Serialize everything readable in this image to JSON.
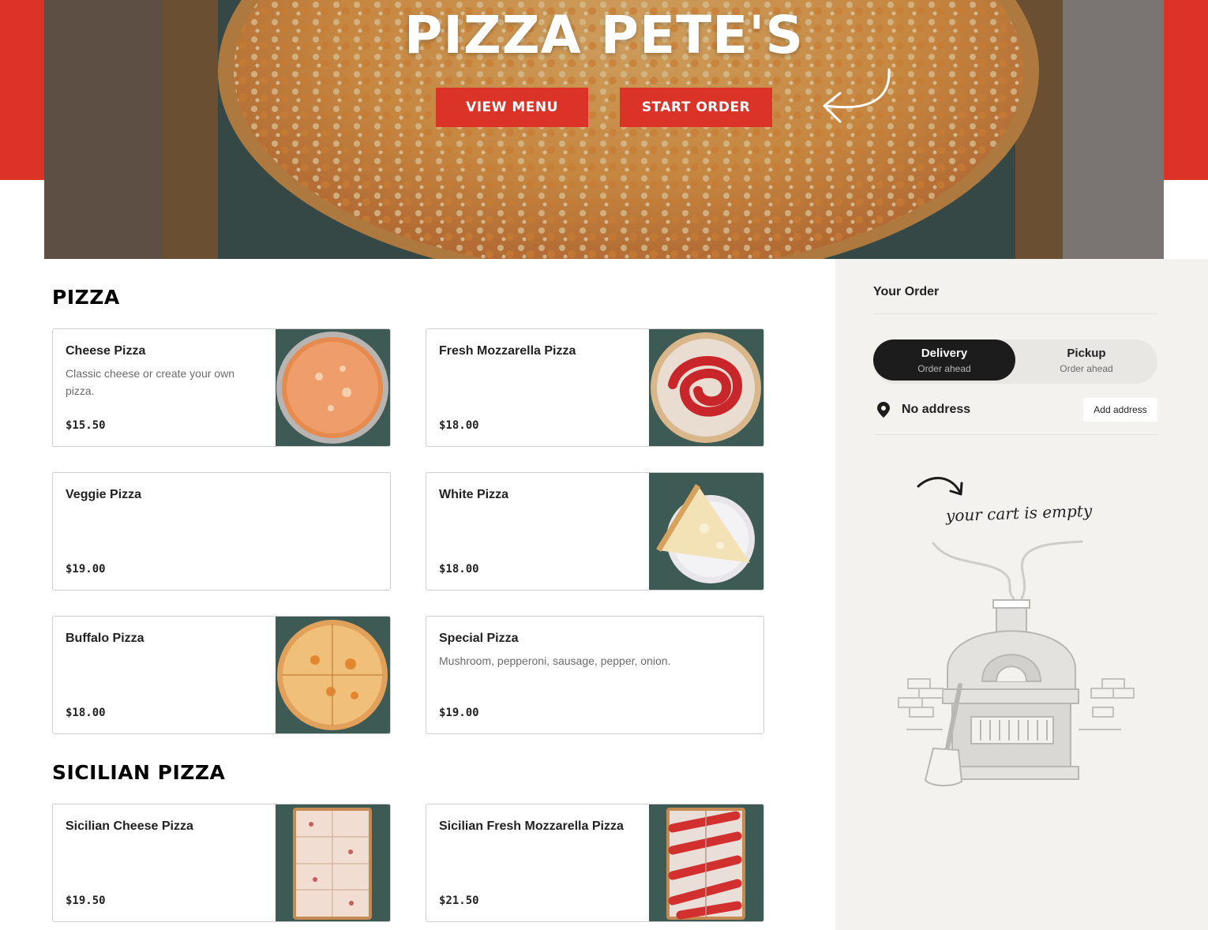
{
  "hero": {
    "title": "PIZZA PETE'S",
    "view_menu_label": "VIEW MENU",
    "start_order_label": "START ORDER"
  },
  "menu": {
    "sections": [
      {
        "title": "PIZZA",
        "items": [
          {
            "name": "Cheese Pizza",
            "description": "Classic cheese or create your own pizza.",
            "price": "$15.50"
          },
          {
            "name": "Fresh Mozzarella Pizza",
            "description": "",
            "price": "$18.00"
          },
          {
            "name": "Veggie Pizza",
            "description": "",
            "price": "$19.00"
          },
          {
            "name": "White Pizza",
            "description": "",
            "price": "$18.00"
          },
          {
            "name": "Buffalo Pizza",
            "description": "",
            "price": "$18.00"
          },
          {
            "name": "Special Pizza",
            "description": "Mushroom, pepperoni, sausage, pepper, onion.",
            "price": "$19.00"
          }
        ]
      },
      {
        "title": "SICILIAN PIZZA",
        "items": [
          {
            "name": "Sicilian Cheese Pizza",
            "description": "",
            "price": "$19.50"
          },
          {
            "name": "Sicilian Fresh Mozzarella Pizza",
            "description": "",
            "price": "$21.50"
          }
        ]
      }
    ]
  },
  "order": {
    "title": "Your Order",
    "delivery_label": "Delivery",
    "delivery_sub": "Order ahead",
    "pickup_label": "Pickup",
    "pickup_sub": "Order ahead",
    "selected_mode": "Delivery",
    "address_text": "No address",
    "add_address_label": "Add address",
    "empty_cart_text": "your cart is empty"
  },
  "colors": {
    "brand_red": "#dc3328",
    "panel_bg": "#f3f2ef",
    "toggle_active": "#1c1c1c"
  }
}
